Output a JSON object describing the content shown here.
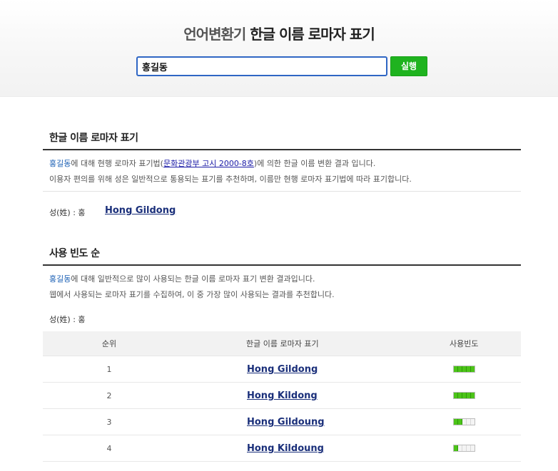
{
  "header": {
    "brand": "언어변환기",
    "subtitle": "한글 이름 로마자 표기",
    "search_value": "홍길동",
    "run_label": "실행"
  },
  "section_official": {
    "title": "한글 이름 로마자 표기",
    "name": "홍길동",
    "line1_a": "에 대해 현행 로마자 표기법(",
    "law_link": "문화관광부 고시 2000-8호",
    "line1_b": ")에 의한 한글 이름 변환 결과 입니다.",
    "line2": "이용자 편의를 위해 성은 일반적으로 통용되는 표기를 추천하며, 이름만 현행 로마자 표기법에 따라 표기합니다.",
    "surname_label": "성(姓) : 홍",
    "romanized": "Hong Gildong"
  },
  "section_frequency": {
    "title": "사용 빈도 순",
    "name": "홍길동",
    "line1": "에 대해 일반적으로 많이 사용되는 한글 이름 로마자 표기 변환 결과입니다.",
    "line2": "웹에서 사용되는 로마자 표기를 수집하여, 이 중 가장 많이 사용되는 결과를 추천합니다.",
    "surname_label": "성(姓) : 홍"
  },
  "table": {
    "headers": {
      "rank": "순위",
      "name": "한글 이름 로마자 표기",
      "freq": "사용빈도"
    },
    "rows": [
      {
        "rank": "1",
        "name": "Hong Gildong",
        "level": 5,
        "max": 5
      },
      {
        "rank": "2",
        "name": "Hong Kildong",
        "level": 5,
        "max": 5
      },
      {
        "rank": "3",
        "name": "Hong Gildoung",
        "level": 2,
        "max": 5
      },
      {
        "rank": "4",
        "name": "Hong Kildoung",
        "level": 1,
        "max": 5
      }
    ]
  }
}
